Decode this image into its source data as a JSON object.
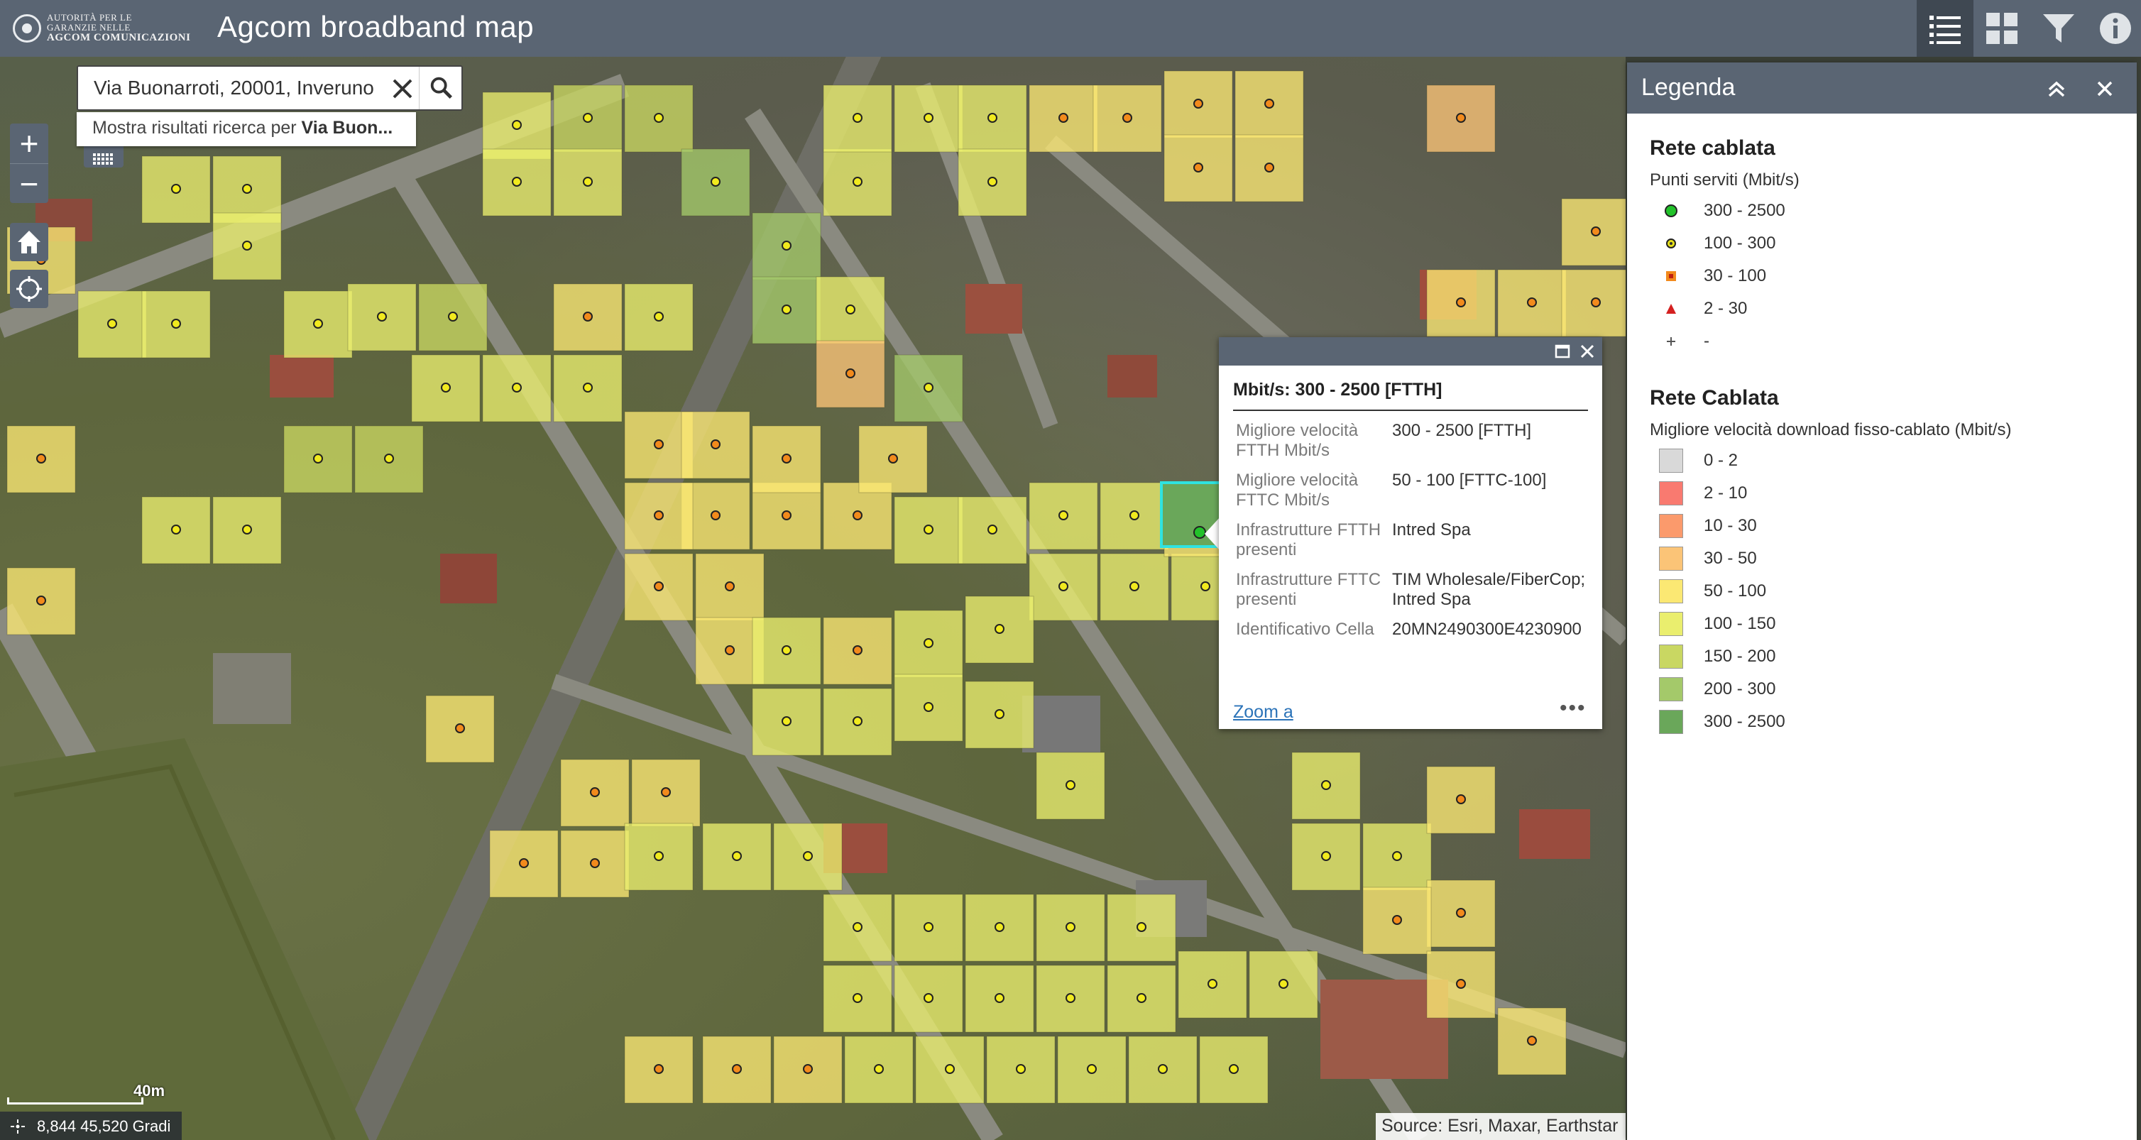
{
  "header": {
    "logo_line1": "AUTORITÀ PER LE",
    "logo_line2": "GARANZIE NELLE",
    "logo_line3": "AGCOM COMUNICAZIONI",
    "title": "Agcom broadband map"
  },
  "icons": {
    "legend": "legend-list-icon",
    "basemap": "basemap-gallery-icon",
    "filter": "filter-icon",
    "info": "info-icon",
    "zoom_in": "+",
    "zoom_out": "−"
  },
  "search": {
    "value": "Via Buonarroti, 20001, Inveruno",
    "suggestion_prefix": "Mostra risultati ricerca per",
    "suggestion_bold": "Via Buon..."
  },
  "map": {
    "scale_label": "40m",
    "coords": "8,844 45,520 Gradi",
    "attribution": "Source: Esri, Maxar, Earthstar"
  },
  "popup": {
    "title": "Mbit/s: 300 - 2500 [FTTH]",
    "rows": [
      {
        "key": "Migliore velocità FTTH Mbit/s",
        "value": "300 - 2500 [FTTH]"
      },
      {
        "key": "Migliore velocità FTTC Mbit/s",
        "value": "50 - 100 [FTTC-100]"
      },
      {
        "key": "Infrastrutture FTTH presenti",
        "value": "Intred Spa"
      },
      {
        "key": "Infrastrutture FTTC presenti",
        "value": "TIM Wholesale/FiberCop; Intred Spa"
      },
      {
        "key": "Identificativo Cella",
        "value": "20MN2490300E4230900"
      }
    ],
    "zoom_link": "Zoom a",
    "more": "•••"
  },
  "legend": {
    "title": "Legenda",
    "section1": {
      "title": "Rete cablata",
      "subtitle": "Punti serviti (Mbit/s)",
      "items": [
        {
          "label": "300 - 2500",
          "symbol": "dot",
          "color": "#22c22a"
        },
        {
          "label": "100 - 300",
          "symbol": "dot-small",
          "color": "#e8e21a"
        },
        {
          "label": "30 - 100",
          "symbol": "square",
          "color": "#f28a1c"
        },
        {
          "label": "2 - 30",
          "symbol": "triangle",
          "color": "#d42020"
        },
        {
          "label": "-",
          "symbol": "cross",
          "color": "#555555"
        }
      ]
    },
    "section2": {
      "title": "Rete Cablata",
      "subtitle": "Migliore velocità download fisso-cablato (Mbit/s)",
      "items": [
        {
          "label": "0 - 2",
          "color": "#d9d9d9"
        },
        {
          "label": "2 - 10",
          "color": "#f97a70"
        },
        {
          "label": "10 - 30",
          "color": "#fb9a6c"
        },
        {
          "label": "30 - 50",
          "color": "#fbc477"
        },
        {
          "label": "50 - 100",
          "color": "#fbe873"
        },
        {
          "label": "100 - 150",
          "color": "#eaee6e"
        },
        {
          "label": "150 - 200",
          "color": "#c9d762"
        },
        {
          "label": "200 - 300",
          "color": "#a4c96a"
        },
        {
          "label": "300 - 2500",
          "color": "#6aa75a"
        }
      ]
    }
  }
}
